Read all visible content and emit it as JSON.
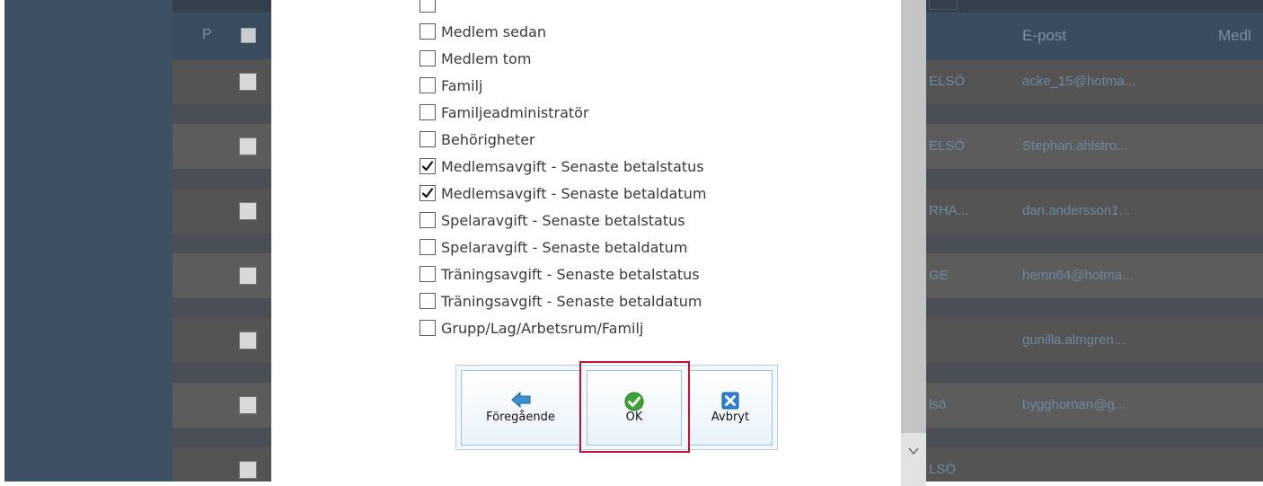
{
  "background_grid": {
    "header": {
      "p": "P",
      "email": "E-post",
      "medl": "Medl"
    },
    "rows": [
      {
        "club": "ELSÖ",
        "email": "acke_15@hotma..."
      },
      {
        "club": "ELSÖ",
        "email": "Stephan.ahlstro..."
      },
      {
        "club": "RHA...",
        "email": "dan.andersson1..."
      },
      {
        "club": "GE",
        "email": "hemn64@hotma..."
      },
      {
        "club": "",
        "email": "gunilla.almgren..."
      },
      {
        "club": "lsö",
        "email": "bygghornan@g..."
      },
      {
        "club": "LSÖ",
        "email": ""
      }
    ]
  },
  "dialog": {
    "options": [
      {
        "label": "",
        "checked": false
      },
      {
        "label": "Medlem sedan",
        "checked": false
      },
      {
        "label": "Medlem tom",
        "checked": false
      },
      {
        "label": "Familj",
        "checked": false
      },
      {
        "label": "Familjeadministratör",
        "checked": false
      },
      {
        "label": "Behörigheter",
        "checked": false
      },
      {
        "label": "Medlemsavgift - Senaste betalstatus",
        "checked": true
      },
      {
        "label": "Medlemsavgift - Senaste betaldatum",
        "checked": true
      },
      {
        "label": "Spelaravgift - Senaste betalstatus",
        "checked": false
      },
      {
        "label": "Spelaravgift - Senaste betaldatum",
        "checked": false
      },
      {
        "label": "Träningsavgift - Senaste betalstatus",
        "checked": false
      },
      {
        "label": "Träningsavgift - Senaste betaldatum",
        "checked": false
      },
      {
        "label": "Grupp/Lag/Arbetsrum/Familj",
        "checked": false
      }
    ],
    "buttons": {
      "previous": {
        "label": "Föregående",
        "icon": "arrow-left-icon"
      },
      "ok": {
        "label": "OK",
        "icon": "checkmark-icon"
      },
      "cancel": {
        "label": "Avbryt",
        "icon": "close-icon"
      }
    }
  },
  "colors": {
    "highlight": "#c8102e",
    "ok_green": "#3aa534",
    "prev_blue": "#3b8fd6",
    "cancel_blue": "#2f7fd1"
  }
}
